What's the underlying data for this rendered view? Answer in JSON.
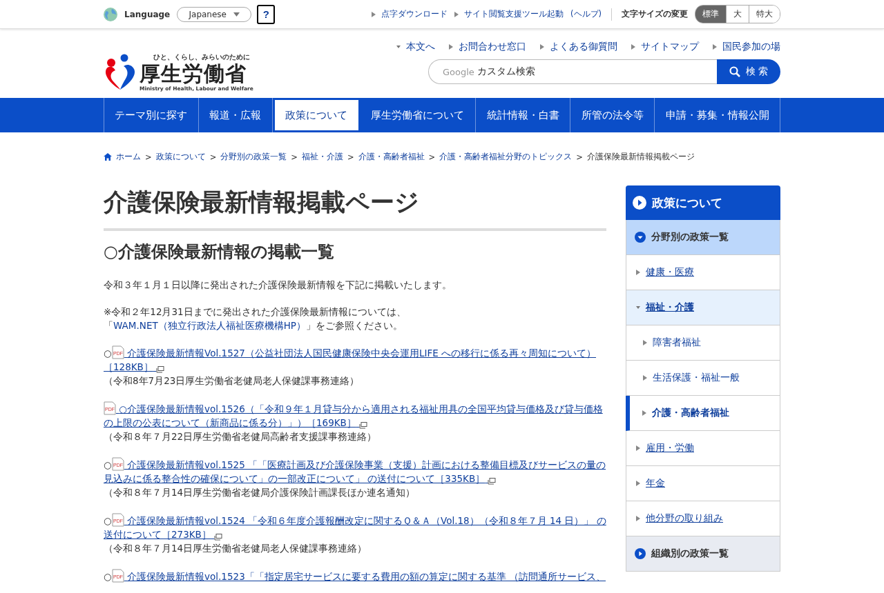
{
  "topbar": {
    "language_label": "Language",
    "language_select": "Japanese",
    "help": "?",
    "links": [
      "点字ダウンロード",
      "サイト閲覧支援ツール起動",
      "(ヘルプ)"
    ],
    "font_size_label": "文字サイズの変更",
    "font_sizes": [
      {
        "label": "標準",
        "selected": true
      },
      {
        "label": "大",
        "selected": false
      },
      {
        "label": "特大",
        "selected": false
      }
    ]
  },
  "header": {
    "logo_tagline": "ひと、くらし、みらいのために",
    "logo_name": "厚生労働省",
    "logo_english": "Ministry of Health, Labour and Welfare",
    "links": [
      {
        "label": "本文へ",
        "kind": "down"
      },
      {
        "label": "お問合わせ窓口",
        "kind": "right"
      },
      {
        "label": "よくある御質問",
        "kind": "right"
      },
      {
        "label": "サイトマップ",
        "kind": "right"
      },
      {
        "label": "国民参加の場",
        "kind": "right"
      }
    ],
    "search": {
      "brand": "Google",
      "placeholder": "カスタム検索",
      "button": "検 索"
    }
  },
  "nav": [
    {
      "label": "テーマ別に探す",
      "selected": false
    },
    {
      "label": "報道・広報",
      "selected": false
    },
    {
      "label": "政策について",
      "selected": true
    },
    {
      "label": "厚生労働省について",
      "selected": false
    },
    {
      "label": "統計情報・白書",
      "selected": false
    },
    {
      "label": "所管の法令等",
      "selected": false
    },
    {
      "label": "申請・募集・情報公開",
      "selected": false
    }
  ],
  "breadcrumb": {
    "separator": ">",
    "links": [
      "ホーム",
      "政策について",
      "分野別の政策一覧",
      "福祉・介護",
      "介護・高齢者福祉",
      "介護・高齢者福祉分野のトピックス"
    ],
    "current": "介護保険最新情報掲載ページ"
  },
  "title": "介護保険最新情報掲載ページ",
  "heading": "○介護保険最新情報の掲載一覧",
  "intro": "令和３年１月１日以降に発出された介護保険最新情報を下記に掲載いたします。",
  "note": {
    "before": "※令和２年12月31日までに発出された介護保険最新情報については、「",
    "link": "WAM.NET（独立行政法人福祉医療機構HP）",
    "after": "」をご参照ください。"
  },
  "entries": [
    {
      "prefix": "○",
      "pdf_label": "PDF",
      "link": "介護保険最新情報Vol.1527（公益社団法人国民健康保険中央会運用LIFE への移行に係る再々周知について）［128KB］",
      "note": "（令和8年7月23日厚生労働省老健局老人保健課事務連絡）"
    },
    {
      "pdf_label": "PDF",
      "link": "○介護保険最新情報vol.1526（「令和９年１月貸与分から適用される福祉用具の全国平均貸与価格及び貸与価格の上限の公表について（新商品に係る分）」）［169KB］",
      "note": "（令和８年７月22日厚生労働省老健局高齢者支援課事務連絡）"
    },
    {
      "prefix": "○",
      "pdf_label": "PDF",
      "link": "介護保険最新情報vol.1525 「「医療計画及び介護保険事業（支援）計画における整備目標及びサービスの量の見込みに係る整合性の確保について」の一部改正について」 の送付について［335KB］",
      "note": "（令和８年７月14日厚生労働省老健局介護保険計画課長ほか連名通知）"
    },
    {
      "prefix": "○",
      "pdf_label": "PDF",
      "link": "介護保険最新情報vol.1524 「令和６年度介護報酬改定に関するＱ＆Ａ（Vol.18）（令和８年７月 14 日）」 の送付について［273KB］",
      "note": "（令和８年７月14日厚生労働省老健局老人保健課事務連絡）"
    },
    {
      "prefix": "○",
      "pdf_label": "PDF",
      "link": "介護保険最新情報vol.1523「「指定居宅サービスに要する費用の額の算定に関する基準 （訪問通所サービス、"
    }
  ],
  "sidebar": {
    "title": "政策について",
    "sections": [
      {
        "label": "分野別の政策一覧",
        "expanded": true,
        "children": [
          {
            "label": "健康・医療",
            "expanded": false,
            "selected": false
          },
          {
            "label": "福祉・介護",
            "expanded": true,
            "selected": false,
            "children": [
              {
                "label": "障害者福祉",
                "selected": false
              },
              {
                "label": "生活保護・福祉一般",
                "selected": false
              },
              {
                "label": "介護・高齢者福祉",
                "selected": true
              }
            ]
          },
          {
            "label": "雇用・労働",
            "expanded": false,
            "selected": false
          },
          {
            "label": "年金",
            "expanded": false,
            "selected": false
          },
          {
            "label": "他分野の取り組み",
            "expanded": false,
            "selected": false
          }
        ]
      },
      {
        "label": "組織別の政策一覧",
        "expanded": false
      }
    ]
  }
}
